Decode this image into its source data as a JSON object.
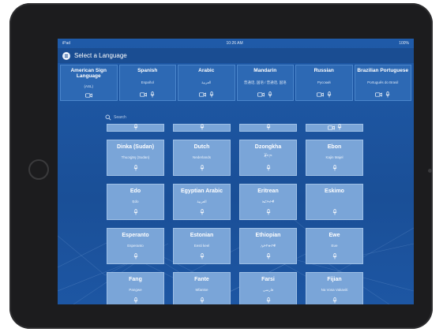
{
  "status": {
    "carrier": "iPad",
    "time": "10:26 AM",
    "battery": "100%"
  },
  "appbar": {
    "title": "Select a Language",
    "menu_icon": "hamburger-icon"
  },
  "featured": [
    {
      "name": "American Sign Language",
      "native": "(ASL)",
      "icons": [
        "video-icon"
      ]
    },
    {
      "name": "Spanish",
      "native": "Español",
      "icons": [
        "video-icon",
        "mic-icon"
      ]
    },
    {
      "name": "Arabic",
      "native": "العربية",
      "icons": [
        "video-icon",
        "mic-icon"
      ]
    },
    {
      "name": "Mandarin",
      "native": "普通话, 国语 / 普通话, 国语",
      "icons": [
        "video-icon",
        "mic-icon"
      ]
    },
    {
      "name": "Russian",
      "native": "Русский",
      "icons": [
        "video-icon",
        "mic-icon"
      ]
    },
    {
      "name": "Brazilian Portuguese",
      "native": "Português do Brasil",
      "icons": [
        "video-icon",
        "mic-icon"
      ]
    }
  ],
  "search": {
    "placeholder": "Search",
    "icon": "search-icon"
  },
  "languages": [
    {
      "name": "Dinka (Sudan)",
      "native": "Thuɔŋjäŋ (Sudan)"
    },
    {
      "name": "Dutch",
      "native": "Nederlands"
    },
    {
      "name": "Dzongkha",
      "native": "རྫོང་ཁ"
    },
    {
      "name": "Ebon",
      "native": "Kajin Majel"
    },
    {
      "name": "Edo",
      "native": "Ẹdo"
    },
    {
      "name": "Egyptian Arabic",
      "native": "العربية"
    },
    {
      "name": "Eritrean",
      "native": "ኤርትራዊ"
    },
    {
      "name": "Eskimo",
      "native": ""
    },
    {
      "name": "Esperanto",
      "native": "Esperanto"
    },
    {
      "name": "Estonian",
      "native": "Eesti keel"
    },
    {
      "name": "Ethiopian",
      "native": "ኢትዮጵያዊ"
    },
    {
      "name": "Ewe",
      "native": "Eʋe"
    },
    {
      "name": "Fang",
      "native": "Pangwe"
    },
    {
      "name": "Fante",
      "native": "Mfantse"
    },
    {
      "name": "Farsi",
      "native": "فارسی"
    },
    {
      "name": "Fijian",
      "native": "Na Vosa Vakaviti"
    }
  ]
}
